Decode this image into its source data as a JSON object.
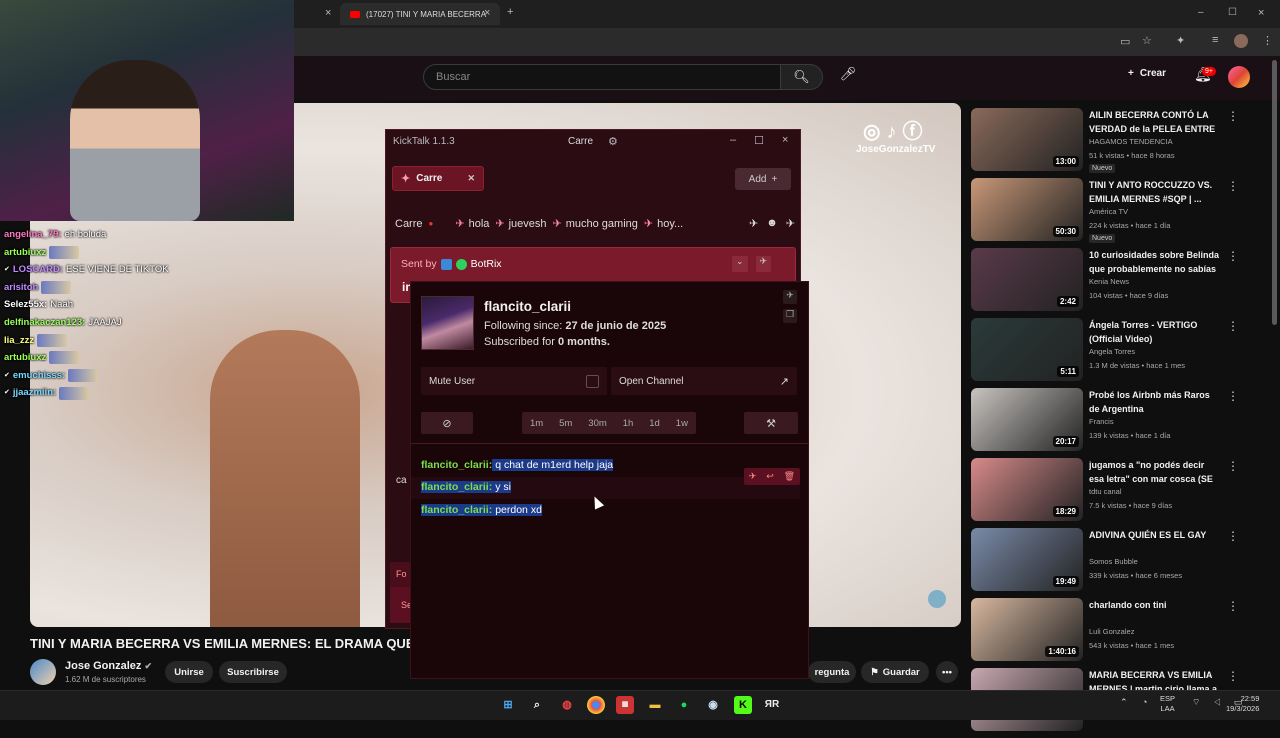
{
  "browser": {
    "tab_title": "(17027) TINI Y MARIA BECERRА",
    "tab_close": "×",
    "new_tab": "+",
    "prev_tab_close": "×",
    "window_controls": [
      "–",
      "☐",
      "×"
    ]
  },
  "youtube": {
    "search_placeholder": "Buscar",
    "create_label": "Crear",
    "notifications_badge": "9+",
    "video_title": "TINI Y MARIA BECERRA VS EMILIA MERNES: EL DRAMA QUE N",
    "channel_name": "Jose Gonzalez",
    "subscribers": "1.62 M de suscriptores",
    "join_label": "Unirse",
    "subscribe_label": "Suscribirse",
    "ask_label": "regunta",
    "save_label": "Guardar",
    "more_label": "•••",
    "watermark_handle": "JoseGonzalezTV",
    "recommendations": [
      {
        "title": "AILIN BECERRA CONTÓ LA VERDAD de la PELEA ENTRE ...",
        "channel": "HAGAMOS TENDENCIA",
        "meta": "51 k vistas • hace 8 horas",
        "duration": "13:00",
        "badge": "Nuevo",
        "thumb_color": "#8a6a5a"
      },
      {
        "title": "TINI Y ANTO ROCCUZZO VS. EMILIA MERNES #SQP | ...",
        "channel": "América TV",
        "meta": "224 k vistas • hace 1 día",
        "duration": "50:30",
        "badge": "Nuevo",
        "thumb_color": "#c89878"
      },
      {
        "title": "10 curiosidades sobre Belinda que probablemente no sabías",
        "channel": "Kenia News",
        "meta": "104 vistas • hace 9 días",
        "duration": "2:42",
        "badge": "",
        "thumb_color": "#5a3a4a"
      },
      {
        "title": "Ángela Torres - VERTIGO (Official Video)",
        "channel": "Angela Torres",
        "meta": "1.3 M de vistas • hace 1 mes",
        "duration": "5:11",
        "badge": "",
        "thumb_color": "#2a3a3a"
      },
      {
        "title": "Probé los Airbnb más Raros de Argentina",
        "channel": "Francis",
        "meta": "139 k vistas • hace 1 día",
        "duration": "20:17",
        "badge": "",
        "thumb_color": "#c8c4c0"
      },
      {
        "title": "jugamos a \"no podés decir esa letra\" con mar cosca (SE PICÓ ...",
        "channel": "tdtu canal",
        "meta": "7.5 k vistas • hace 9 días",
        "duration": "18:29",
        "badge": "",
        "thumb_color": "#d88a8a"
      },
      {
        "title": "ADIVINA QUIÉN ES EL GAY",
        "channel": "Somos Bubble",
        "meta": "339 k vistas • hace 6 meses",
        "duration": "19:49",
        "badge": "",
        "thumb_color": "#7a8aa8"
      },
      {
        "title": "charlando con tini",
        "channel": "Luli Gonzalez",
        "meta": "543 k vistas • hace 1 mes",
        "duration": "1:40:16",
        "badge": "",
        "thumb_color": "#d8b8a0"
      },
      {
        "title": "MARIA BECERRA VS EMILIA MERNES | martin cirio llama a ...",
        "channel": "",
        "meta": "",
        "duration": "",
        "badge": "",
        "thumb_color": "#c8a8b0"
      }
    ]
  },
  "stream_chat": [
    {
      "user": "angelina_79:",
      "text": "eh boluda",
      "color": "#ff7ac0",
      "prefix": "",
      "emote": false
    },
    {
      "user": "artubiuxz",
      "text": "",
      "color": "#9aff5a",
      "prefix": "",
      "emote": true
    },
    {
      "user": "LOSCARD:",
      "text": "ESE VIENE DE TIKTOK",
      "color": "#c08aff",
      "prefix": "✔",
      "emote": false
    },
    {
      "user": "arisitoh",
      "text": "",
      "color": "#c08aff",
      "prefix": "",
      "emote": true
    },
    {
      "user": "Selez55x:",
      "text": "Naah",
      "color": "#ffffff",
      "prefix": "",
      "emote": false
    },
    {
      "user": "delfinakaczan123:",
      "text": "JAAJAJ",
      "color": "#9aff5a",
      "prefix": "",
      "emote": false
    },
    {
      "user": "lia_zzz",
      "text": "",
      "color": "#ffff7a",
      "prefix": "",
      "emote": true
    },
    {
      "user": "artubiuxz",
      "text": "",
      "color": "#9aff5a",
      "prefix": "",
      "emote": true
    },
    {
      "user": "emuchisss:",
      "text": "",
      "color": "#7ad8ff",
      "prefix": "✔",
      "emote": true
    },
    {
      "user": "jjaazmiin:",
      "text": "",
      "color": "#7ad8ff",
      "prefix": "✔",
      "emote": true
    }
  ],
  "kicktalk": {
    "app_title": "KickTalk 1.1.3",
    "window_tab": "Carre",
    "channel_tab": "Carre",
    "add_label": "Add",
    "channel_bar_name": "Carre",
    "channel_bar_tags": [
      "hola",
      "juevesh",
      "mucho gaming",
      "hoy..."
    ],
    "sent_by_label": "Sent by",
    "sent_by_user": "BotRix",
    "pinned_preview": "in",
    "partial_left_1": "ca",
    "partial_left_2": "Fo",
    "partial_left_3": "Se",
    "user_card": {
      "username": "flancito_clarii",
      "following_label": "Following since:",
      "following_date": "27 de junio de 2025",
      "subscribed_label": "Subscribed for",
      "subscribed_value": "0 months.",
      "mute_label": "Mute User",
      "open_channel_label": "Open Channel",
      "timeouts": [
        "1m",
        "5m",
        "30m",
        "1h",
        "1d",
        "1w"
      ],
      "messages": [
        {
          "user": "flancito_clarii:",
          "text": "q chat de m1erd help jaja"
        },
        {
          "user": "flancito_clarii:",
          "text": "y si"
        },
        {
          "user": "flancito_clarii:",
          "text": "perdon xd"
        }
      ]
    }
  },
  "taskbar": {
    "lang_1": "ESP",
    "lang_2": "LAA",
    "time": "22:59",
    "date": "19/3/2026"
  }
}
